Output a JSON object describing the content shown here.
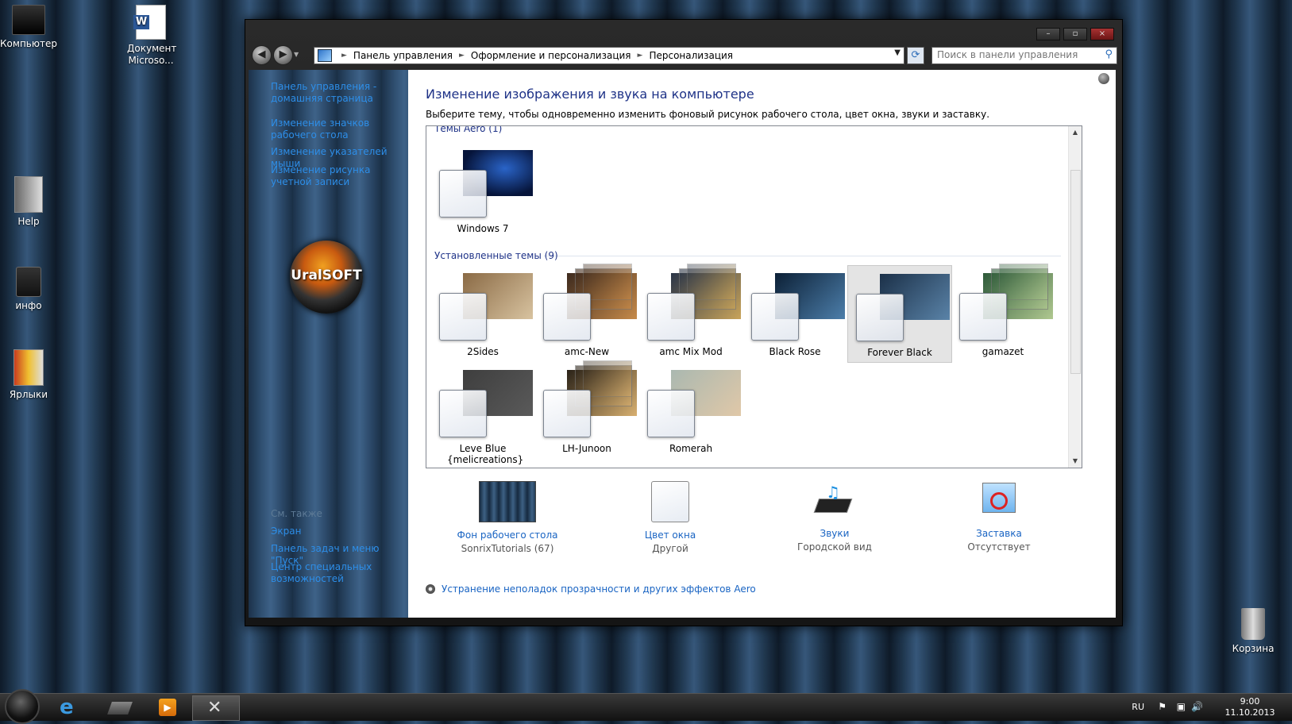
{
  "desktop": {
    "icons": [
      {
        "label": "Компьютер"
      },
      {
        "label": "Документ Microso..."
      },
      {
        "label": "Help"
      },
      {
        "label": "инфо"
      },
      {
        "label": "Ярлыки"
      },
      {
        "label": "Корзина"
      }
    ]
  },
  "window": {
    "controls": {
      "minimize": "–",
      "maximize": "▫",
      "close": "×"
    },
    "nav": {
      "back_glyph": "◀",
      "forward_glyph": "▶",
      "crumbs": [
        "Панель управления",
        "Оформление и персонализация",
        "Персонализация"
      ],
      "search_placeholder": "Поиск в панели управления"
    },
    "sidebar": {
      "links": [
        "Панель управления - домашняя страница",
        "Изменение значков рабочего стола",
        "Изменение указателей мыши",
        "Изменение рисунка учетной записи"
      ],
      "logo_text": "UralSOFT",
      "see_also_title": "См. также",
      "see_also": [
        "Экран",
        "Панель задач и меню \"Пуск\"",
        "Центр специальных возможностей"
      ]
    },
    "main": {
      "title": "Изменение изображения и звука на компьютере",
      "description": "Выберите тему, чтобы одновременно изменить фоновый рисунок рабочего стола, цвет окна, звуки и заставку.",
      "aero_group": "Темы Aero (1)",
      "aero_themes": [
        {
          "name": "Windows 7",
          "colors": [
            "#06143a",
            "#2a64c8"
          ]
        }
      ],
      "installed_group": "Установленные темы (9)",
      "installed_themes": [
        {
          "name": "2Sides",
          "colors": [
            "#8a6a45",
            "#d8c3a0"
          ],
          "selected": false
        },
        {
          "name": "amc-New",
          "colors": [
            "#3d2a1e",
            "#c68a4a"
          ],
          "selected": false
        },
        {
          "name": "amc Mix Mod",
          "colors": [
            "#2a3548",
            "#c9a45a"
          ],
          "selected": false
        },
        {
          "name": "Black Rose",
          "colors": [
            "#0c2036",
            "#4c7eaa"
          ],
          "selected": false
        },
        {
          "name": "Forever Black",
          "colors": [
            "#1b3048",
            "#5a83a8"
          ],
          "selected": true
        },
        {
          "name": "gamazet",
          "colors": [
            "#2e5a3a",
            "#b0c890"
          ],
          "selected": false
        },
        {
          "name": "Leve Blue {melicreations}",
          "colors": [
            "#3e3e3e",
            "#5a5a5a"
          ],
          "selected": false
        },
        {
          "name": "LH-Junoon",
          "colors": [
            "#2a2218",
            "#d8b070"
          ],
          "selected": false
        },
        {
          "name": "Romerah",
          "colors": [
            "#aab8b0",
            "#e0c8a8"
          ],
          "selected": false
        }
      ],
      "bottom": [
        {
          "link": "Фон рабочего стола",
          "value": "SonrixTutorials (67)"
        },
        {
          "link": "Цвет окна",
          "value": "Другой"
        },
        {
          "link": "Звуки",
          "value": "Городской вид"
        },
        {
          "link": "Заставка",
          "value": "Отсутствует"
        }
      ],
      "troubleshoot": "Устранение неполадок прозрачности и других эффектов Aero"
    }
  },
  "taskbar": {
    "lang": "RU",
    "time": "9:00",
    "date": "11.10.2013"
  },
  "colors": {
    "link": "#1964c3",
    "title": "#1e3287",
    "sidebar_link": "#2d8ee8"
  }
}
